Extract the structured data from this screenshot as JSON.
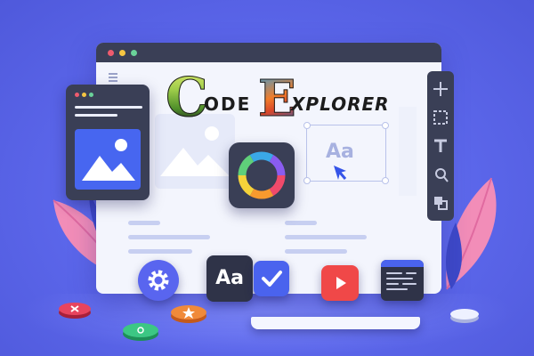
{
  "logo": {
    "first_initial": "C",
    "first_rest": "ODE",
    "second_initial": "E",
    "second_rest": "XPLORER"
  },
  "window": {
    "ghost_text": "Aa"
  },
  "tiles": {
    "font_tile": "Aa"
  },
  "icons": {
    "menu": "menu-icon",
    "toolbar": [
      "move-icon",
      "select-icon",
      "text-icon",
      "pen-icon",
      "layers-icon"
    ],
    "bottom": [
      "gear-icon",
      "font-icon",
      "check-icon",
      "play-icon",
      "code-icon"
    ]
  },
  "colors": {
    "background": "#5863e6",
    "panel_dark": "#3a3f56",
    "accent_blue": "#4a63ee",
    "youtube_red": "#f04848",
    "leaf_pink": "#f48fb4"
  }
}
